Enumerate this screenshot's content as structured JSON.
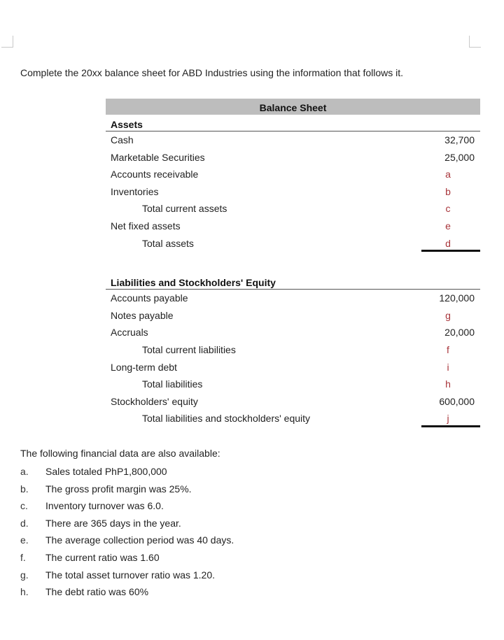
{
  "instruction": "Complete the 20xx balance sheet for ABD Industries using the information that follows it.",
  "balance_sheet": {
    "title": "Balance Sheet",
    "assets": {
      "heading": "Assets",
      "rows": [
        {
          "label": "Cash",
          "value": "32,700",
          "blank": false,
          "indent": false
        },
        {
          "label": "Marketable Securities",
          "value": "25,000",
          "blank": false,
          "indent": false
        },
        {
          "label": "Accounts receivable",
          "value": "a",
          "blank": true,
          "indent": false
        },
        {
          "label": "Inventories",
          "value": "b",
          "blank": true,
          "indent": false
        },
        {
          "label": "Total current assets",
          "value": "c",
          "blank": true,
          "indent": true
        },
        {
          "label": "Net fixed assets",
          "value": "e",
          "blank": true,
          "indent": false
        },
        {
          "label": "Total assets",
          "value": "d",
          "blank": true,
          "indent": true
        }
      ]
    },
    "liabilities": {
      "heading": "Liabilities and Stockholders' Equity",
      "rows": [
        {
          "label": "Accounts payable",
          "value": "120,000",
          "blank": false,
          "indent": false
        },
        {
          "label": "Notes payable",
          "value": "g",
          "blank": true,
          "indent": false
        },
        {
          "label": "Accruals",
          "value": "20,000",
          "blank": false,
          "indent": false
        },
        {
          "label": "Total current liabilities",
          "value": "f",
          "blank": true,
          "indent": true
        },
        {
          "label": "Long-term debt",
          "value": "i",
          "blank": true,
          "indent": false
        },
        {
          "label": "Total liabilities",
          "value": "h",
          "blank": true,
          "indent": true
        },
        {
          "label": "Stockholders' equity",
          "value": "600,000",
          "blank": false,
          "indent": false
        },
        {
          "label": "Total liabilities and stockholders' equity",
          "value": "j",
          "blank": true,
          "indent": true
        }
      ]
    }
  },
  "financial_data": {
    "heading": "The following financial data are also available:",
    "items": [
      {
        "marker": "a.",
        "text": "Sales totaled PhP1,800,000"
      },
      {
        "marker": "b.",
        "text": "The gross profit margin was 25%."
      },
      {
        "marker": "c.",
        "text": "Inventory turnover was 6.0."
      },
      {
        "marker": "d.",
        "text": "There are 365 days in the year."
      },
      {
        "marker": "e.",
        "text": "The average collection period was 40 days."
      },
      {
        "marker": "f.",
        "text": "The current ratio was 1.60"
      },
      {
        "marker": "g.",
        "text": "The total asset turnover ratio was 1.20."
      },
      {
        "marker": "h.",
        "text": "The debt ratio was 60%"
      }
    ]
  },
  "colors": {
    "blank_letter": "#a8343a",
    "title_bar": "#bdbdbd"
  }
}
